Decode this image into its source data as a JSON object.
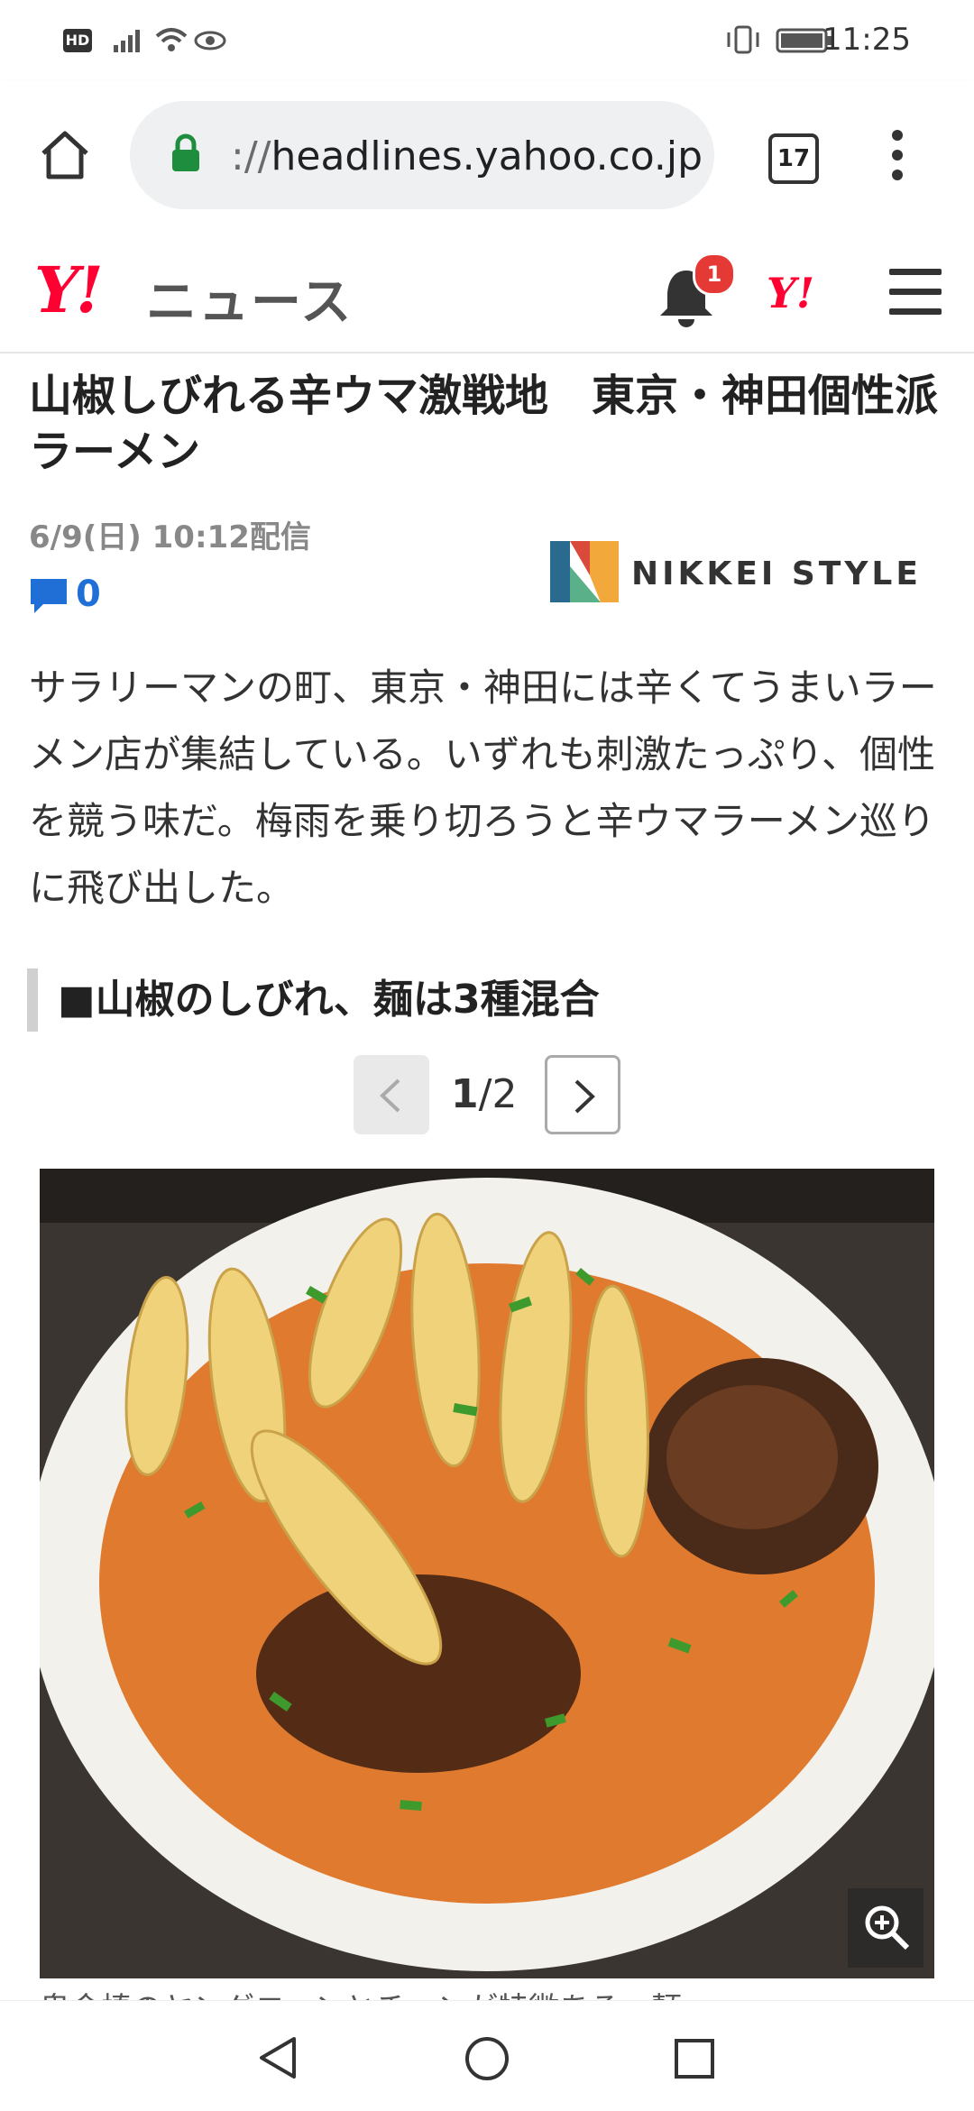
{
  "status_bar": {
    "hd_label": "HD",
    "time": "11:25"
  },
  "browser": {
    "url_prefix": "://",
    "url_host": "headlines.yahoo.co.jp",
    "tab_count": "17"
  },
  "yahoo_header": {
    "logo": "Y!",
    "service_name": "ニュース",
    "notification_count": "1",
    "logo_small": "Y!"
  },
  "article": {
    "title": "山椒しびれる辛ウマ激戦地　東京・神田個性派ラーメン",
    "date": "6/9(日) 10:12配信",
    "comment_count": "0",
    "publisher": "NIKKEI STYLE",
    "lead": "サラリーマンの町、東京・神田には辛くてうまいラーメン店が集結している。いずれも刺激たっぷり、個性を競う味だ。梅雨を乗り切ろうと辛ウマラーメン巡りに飛び出した。",
    "subheading": "■山椒のしびれ、麺は3種混合",
    "pager": {
      "current": "1",
      "total": "/2"
    },
    "photo_caption": "鬼金棒のヤングコーンとチャンが特徴ある一麺"
  },
  "colors": {
    "yahoo_red": "#ff0033",
    "comment_blue": "#1f6fd6",
    "badge_red": "#e53935"
  }
}
